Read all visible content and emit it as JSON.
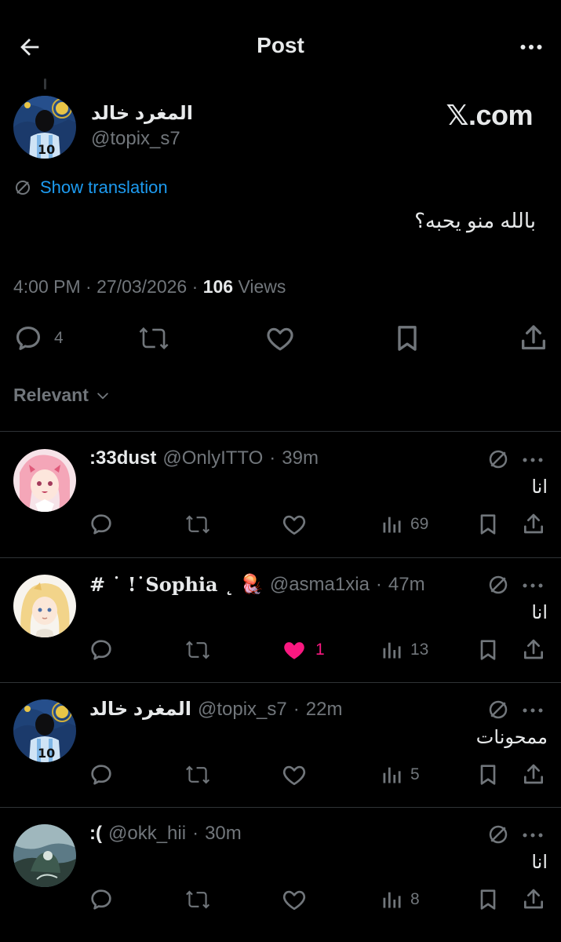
{
  "header": {
    "title": "Post"
  },
  "post": {
    "author_name": "المغرد خالد",
    "author_handle": "@topix_s7",
    "watermark": "𝕏.com",
    "translate_label": "Show translation",
    "text": "بالله منو يحبه؟",
    "time": "4:00 PM",
    "date": "27/03/2026",
    "views_count": "106",
    "views_label": "Views",
    "reply_count": "4"
  },
  "sort": {
    "label": "Relevant"
  },
  "replies": [
    {
      "name": ":33dust",
      "handle": "@OnlyITTO",
      "time": "39m",
      "text": "انا",
      "likes": "",
      "views": "69",
      "liked": false
    },
    {
      "name": "# ˙ !˙Sophia ˛",
      "emoji": "🪼",
      "handle": "@asma1xia",
      "time": "47m",
      "text": "انا",
      "likes": "1",
      "views": "13",
      "liked": true
    },
    {
      "name": "المغرد خالد",
      "handle": "@topix_s7",
      "time": "22m",
      "text": "ممحونات",
      "likes": "",
      "views": "5",
      "liked": false
    },
    {
      "name": ":(",
      "handle": "@okk_hii",
      "time": "30m",
      "text": "انا",
      "likes": "",
      "views": "8",
      "liked": false
    }
  ],
  "colors": {
    "background": "#000000",
    "text": "#e7e9ea",
    "muted": "#71767b",
    "link": "#1d9bf0",
    "like": "#f91880",
    "divider": "#2f3336"
  }
}
